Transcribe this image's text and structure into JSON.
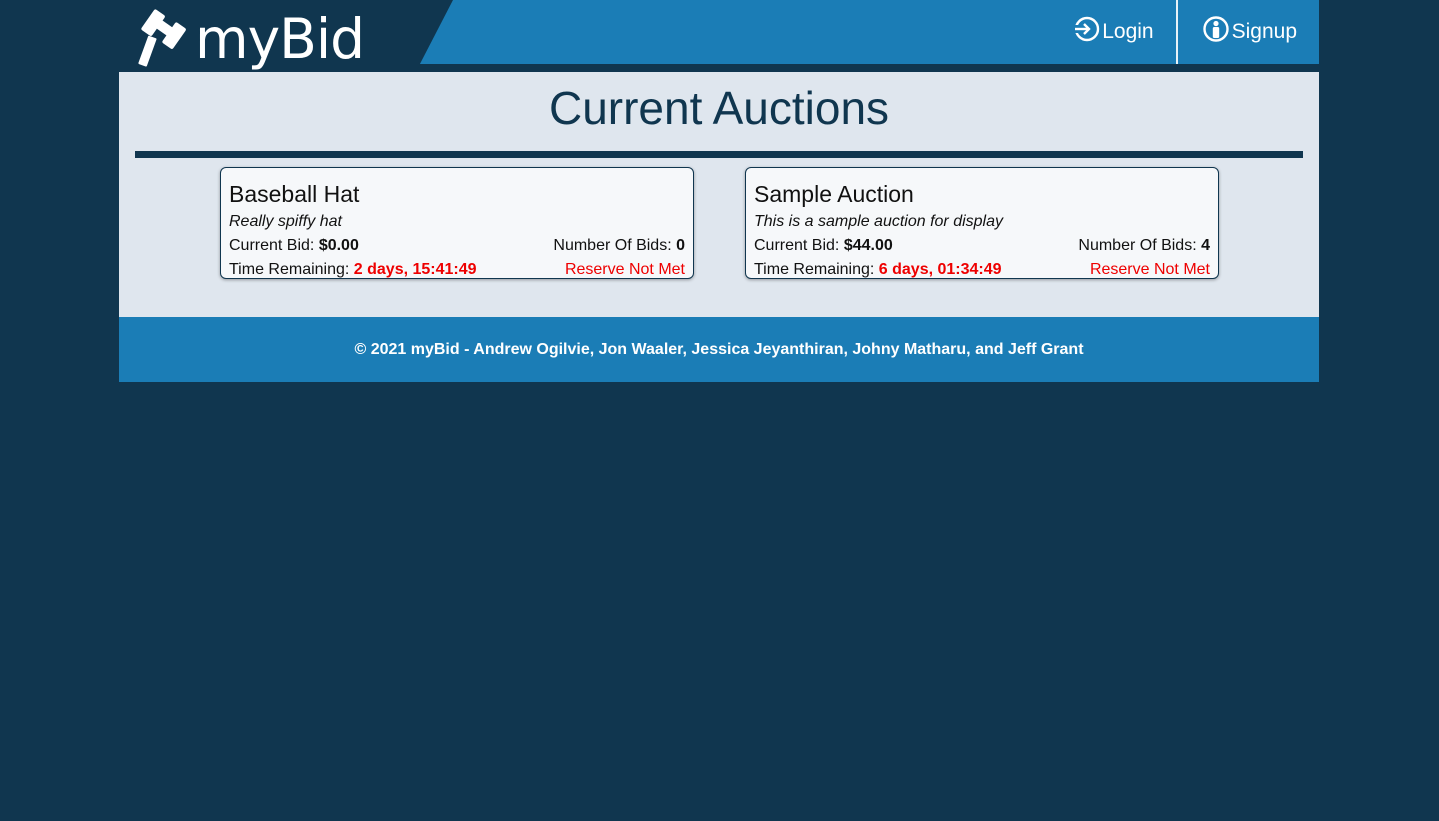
{
  "brand": {
    "name": "myBid",
    "logo_icon": "gavel-icon"
  },
  "nav": {
    "login": {
      "label": "Login",
      "icon": "login-icon"
    },
    "signup": {
      "label": "Signup",
      "icon": "user-circle-icon"
    }
  },
  "page": {
    "title": "Current Auctions"
  },
  "labels": {
    "current_bid": "Current Bid: ",
    "number_of_bids": "Number Of Bids: ",
    "time_remaining": "Time Remaining: "
  },
  "auctions": [
    {
      "title": "Baseball Hat",
      "description": "Really spiffy hat",
      "current_bid": "$0.00",
      "number_of_bids": "0",
      "time_remaining": "2 days, 15:41:49",
      "reserve_status": "Reserve Not Met"
    },
    {
      "title": "Sample Auction",
      "description": "This is a sample auction for display",
      "current_bid": "$44.00",
      "number_of_bids": "4",
      "time_remaining": "6 days, 01:34:49",
      "reserve_status": "Reserve Not Met"
    }
  ],
  "footer": {
    "text": "© 2021 myBid - Andrew Ogilvie, Jon Waaler, Jessica Jeyanthiran, Johny Matharu, and Jeff Grant"
  },
  "colors": {
    "background": "#10364f",
    "header_blue": "#1b7db6",
    "panel": "#dfe6ee",
    "card": "#f6f8fa",
    "alert_red": "#ee0000"
  }
}
